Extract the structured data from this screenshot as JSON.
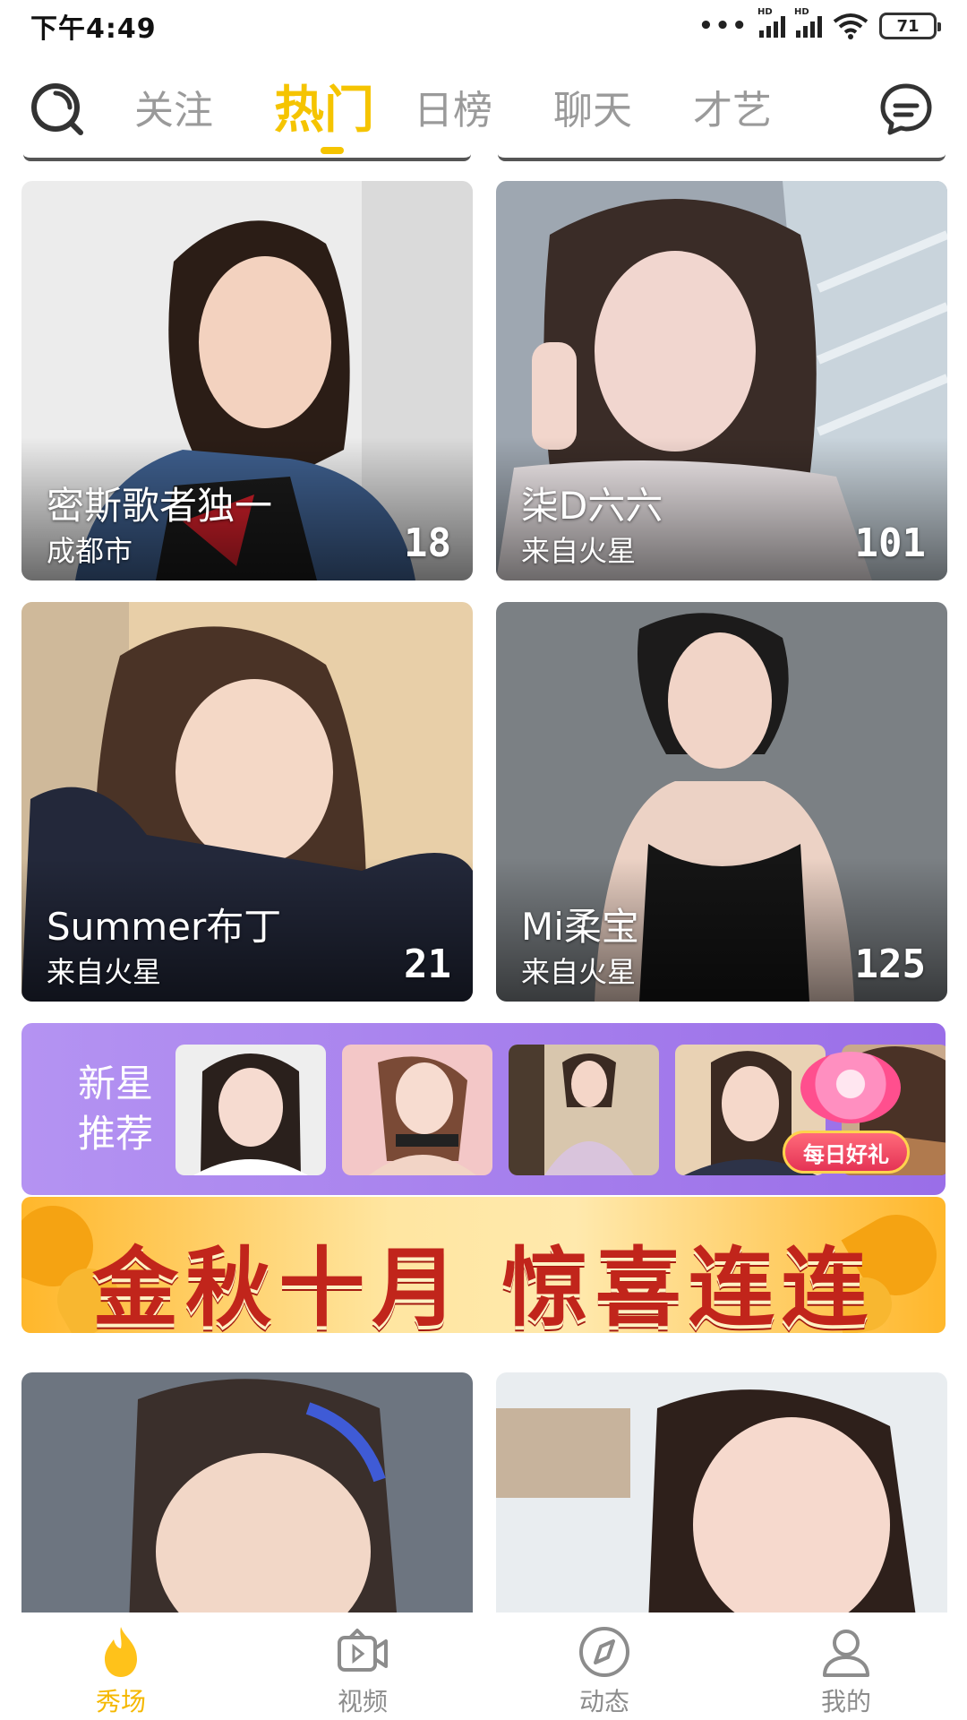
{
  "status": {
    "time": "下午4:49",
    "signal1": "HD",
    "signal2": "HD",
    "battery": "71"
  },
  "nav": {
    "tabs": [
      "关注",
      "热门",
      "日榜",
      "聊天",
      "才艺"
    ],
    "active_tab": "热门"
  },
  "cards": [
    {
      "name": "密斯歌者独一",
      "location": "成都市",
      "count": "18"
    },
    {
      "name": "柒D六六",
      "location": "来自火星",
      "count": "101"
    },
    {
      "name": "Summer布丁",
      "location": "来自火星",
      "count": "21"
    },
    {
      "name": "Mi柔宝",
      "location": "来自火星",
      "count": "125"
    }
  ],
  "new_star": {
    "label_line1": "新星",
    "label_line2": "推荐",
    "badge": "每日好礼"
  },
  "promo": {
    "text": "金秋十月 惊喜连连"
  },
  "tabbar": [
    {
      "label": "秀场",
      "icon": "flame-icon"
    },
    {
      "label": "视频",
      "icon": "video-icon"
    },
    {
      "label": "动态",
      "icon": "compass-icon"
    },
    {
      "label": "我的",
      "icon": "profile-icon"
    }
  ],
  "colors": {
    "accent": "#f5c400",
    "tab_inactive": "#9a9a9a",
    "new_star_bg": "#a47cec",
    "promo_red": "#c1251b"
  }
}
